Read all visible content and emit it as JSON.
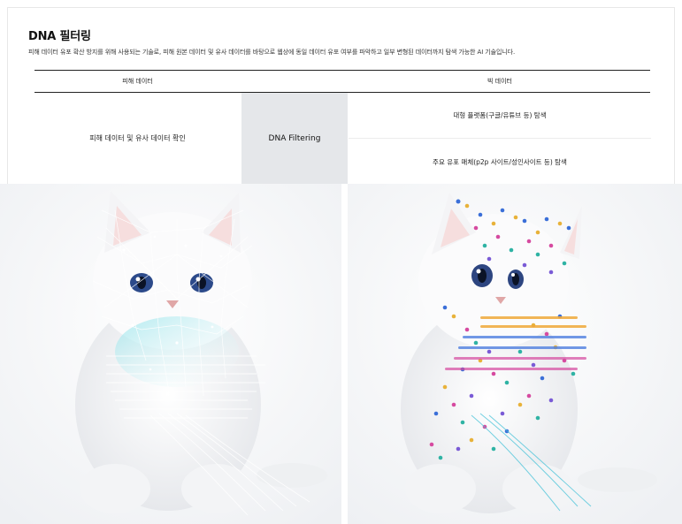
{
  "section": {
    "title": "DNA 필터링",
    "description": "피해 데이터 유포 확산 방지를 위해 사용되는 기술로, 피해 원본 데이터 및 유사 데이터를 바탕으로 웹상에 동일 데이터 유포 여부를 파악하고 일부 변형된 데이터까지 탐색 가능한 AI 기술입니다."
  },
  "table": {
    "left_header": "피해 데이터",
    "right_header": "빅 데이터",
    "left_cell": "피해 데이터 및 유사 데이터 확인",
    "middle_cell": "DNA Filtering",
    "right_rows": [
      "대형 플랫폼(구글/유튜브 등) 탐색",
      "주요 유포 매체(p2p 사이트/성인사이트 등) 탐색"
    ]
  },
  "images": {
    "left_icon": "kitten-wireframe-image",
    "right_icon": "kitten-dot-pattern-image"
  }
}
